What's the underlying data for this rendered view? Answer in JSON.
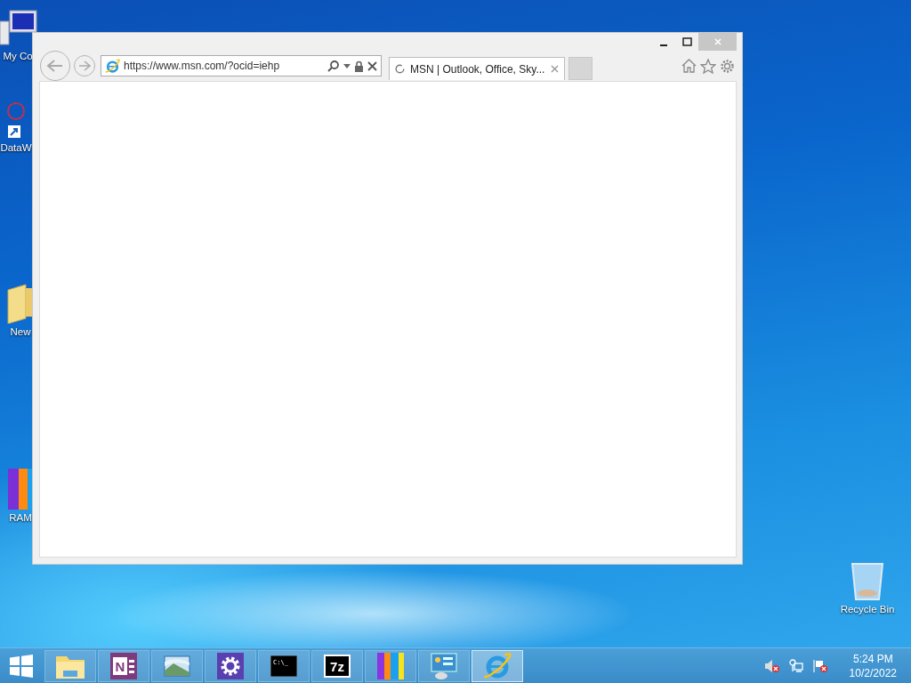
{
  "desktop_icons": [
    {
      "label": "My Co",
      "kind": "computer"
    },
    {
      "label": "DataW",
      "kind": "shortcut"
    },
    {
      "label": "New",
      "kind": "folder"
    },
    {
      "label": "RAM",
      "kind": "bars"
    },
    {
      "label": "Recycle Bin",
      "kind": "bin"
    }
  ],
  "browser": {
    "address": "https://www.msn.com/?ocid=iehp",
    "tabs": [
      {
        "title": "MSN | Outlook, Office, Sky...",
        "selected": true
      }
    ]
  },
  "taskbar": {
    "items": [
      {
        "kind": "explorer",
        "selected": false
      },
      {
        "kind": "onenote",
        "glyph": "N",
        "selected": false
      },
      {
        "kind": "photos",
        "selected": false
      },
      {
        "kind": "settings",
        "selected": false
      },
      {
        "kind": "cmd",
        "glyph": "C:\\_",
        "selected": false
      },
      {
        "kind": "sevenzip",
        "glyph": "7z",
        "selected": false
      },
      {
        "kind": "bars",
        "selected": false
      },
      {
        "kind": "control",
        "selected": false
      },
      {
        "kind": "ie",
        "selected": true
      }
    ]
  },
  "tray": {
    "time": "5:24 PM",
    "date": "10/2/2022"
  }
}
